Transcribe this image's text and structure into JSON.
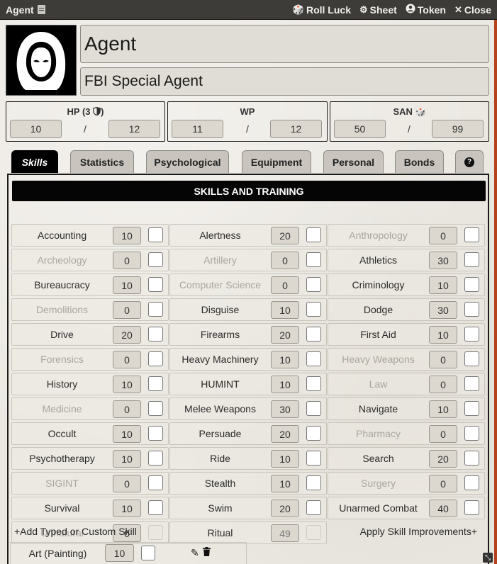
{
  "window": {
    "title": "Agent",
    "actions": [
      {
        "label": "Roll Luck",
        "icon": "dice-icon"
      },
      {
        "label": "Sheet",
        "icon": "gear-icon"
      },
      {
        "label": "Token",
        "icon": "user-circle-icon"
      },
      {
        "label": "Close",
        "icon": "close-icon"
      }
    ]
  },
  "agent": {
    "name": "Agent",
    "profession": "FBI Special Agent"
  },
  "stats": {
    "hp": {
      "label": "HP (3",
      "current": "10",
      "max": "12"
    },
    "wp": {
      "label": "WP",
      "current": "11",
      "max": "12"
    },
    "san": {
      "label": "SAN",
      "current": "50",
      "max": "99"
    },
    "slash": "/"
  },
  "tabs": [
    {
      "label": "Skills",
      "active": true
    },
    {
      "label": "Statistics"
    },
    {
      "label": "Psychological"
    },
    {
      "label": "Equipment"
    },
    {
      "label": "Personal"
    },
    {
      "label": "Bonds"
    },
    {
      "label": "?"
    }
  ],
  "skills_header": "SKILLS AND TRAINING",
  "skills": [
    {
      "name": "Accounting",
      "value": "10",
      "dim": false
    },
    {
      "name": "Alertness",
      "value": "20",
      "dim": false
    },
    {
      "name": "Anthropology",
      "value": "0",
      "dim": true
    },
    {
      "name": "Archeology",
      "value": "0",
      "dim": true
    },
    {
      "name": "Artillery",
      "value": "0",
      "dim": true
    },
    {
      "name": "Athletics",
      "value": "30",
      "dim": false
    },
    {
      "name": "Bureaucracy",
      "value": "10",
      "dim": false
    },
    {
      "name": "Computer Science",
      "value": "0",
      "dim": true
    },
    {
      "name": "Criminology",
      "value": "10",
      "dim": false
    },
    {
      "name": "Demolitions",
      "value": "0",
      "dim": true
    },
    {
      "name": "Disguise",
      "value": "10",
      "dim": false
    },
    {
      "name": "Dodge",
      "value": "30",
      "dim": false
    },
    {
      "name": "Drive",
      "value": "20",
      "dim": false
    },
    {
      "name": "Firearms",
      "value": "20",
      "dim": false
    },
    {
      "name": "First Aid",
      "value": "10",
      "dim": false
    },
    {
      "name": "Forensics",
      "value": "0",
      "dim": true
    },
    {
      "name": "Heavy Machinery",
      "value": "10",
      "dim": false
    },
    {
      "name": "Heavy Weapons",
      "value": "0",
      "dim": true
    },
    {
      "name": "History",
      "value": "10",
      "dim": false
    },
    {
      "name": "HUMINT",
      "value": "10",
      "dim": false
    },
    {
      "name": "Law",
      "value": "0",
      "dim": true
    },
    {
      "name": "Medicine",
      "value": "0",
      "dim": true
    },
    {
      "name": "Melee Weapons",
      "value": "30",
      "dim": false
    },
    {
      "name": "Navigate",
      "value": "10",
      "dim": false
    },
    {
      "name": "Occult",
      "value": "10",
      "dim": false
    },
    {
      "name": "Persuade",
      "value": "20",
      "dim": false
    },
    {
      "name": "Pharmacy",
      "value": "0",
      "dim": true
    },
    {
      "name": "Psychotherapy",
      "value": "10",
      "dim": false
    },
    {
      "name": "Ride",
      "value": "10",
      "dim": false
    },
    {
      "name": "Search",
      "value": "20",
      "dim": false
    },
    {
      "name": "SIGINT",
      "value": "0",
      "dim": true
    },
    {
      "name": "Stealth",
      "value": "10",
      "dim": false
    },
    {
      "name": "Surgery",
      "value": "0",
      "dim": true
    },
    {
      "name": "Survival",
      "value": "10",
      "dim": false
    },
    {
      "name": "Swim",
      "value": "20",
      "dim": false
    },
    {
      "name": "Unarmed Combat",
      "value": "40",
      "dim": false
    },
    {
      "name": "Unnatural",
      "value": "0",
      "dim": true,
      "checkbox_disabled": true
    },
    {
      "name": "Ritual",
      "value": "49",
      "dim": false,
      "checkbox_disabled": true,
      "readonly": true
    }
  ],
  "add_skill_label": "+Add Typed or Custom Skill",
  "apply_improvements_label": "Apply Skill Improvements+",
  "custom_skills": [
    {
      "name": "Art (Painting)",
      "value": "10"
    }
  ]
}
